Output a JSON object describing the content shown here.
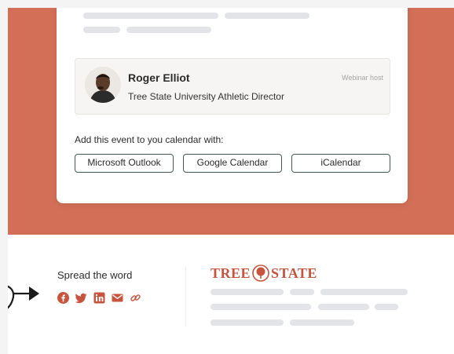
{
  "host": {
    "name": "Roger Elliot",
    "title": "Tree State University Athletic Director",
    "role": "Webinar host"
  },
  "calendar": {
    "label": "Add this event to you calendar with:",
    "options": [
      "Microsoft Outlook",
      "Google Calendar",
      "iCalendar"
    ]
  },
  "share": {
    "title": "Spread the word",
    "icons": [
      "facebook-icon",
      "twitter-icon",
      "linkedin-icon",
      "email-icon",
      "link-icon"
    ]
  },
  "brand": {
    "logo_left": "TREE",
    "logo_right": "STATE"
  },
  "colors": {
    "hero": "#d36f57",
    "accent": "#c9533d",
    "button_border": "#3e5a50",
    "placeholder": "#e3e4e7"
  }
}
